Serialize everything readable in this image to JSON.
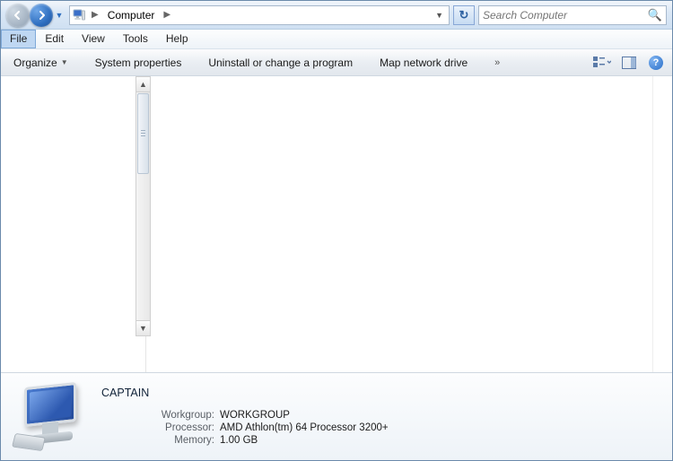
{
  "nav": {
    "breadcrumb_root": "Computer",
    "search_placeholder": "Search Computer"
  },
  "menu": {
    "file": "File",
    "edit": "Edit",
    "view": "View",
    "tools": "Tools",
    "help": "Help"
  },
  "toolbar": {
    "organize": "Organize",
    "system_properties": "System properties",
    "uninstall": "Uninstall or change a program",
    "map_drive": "Map network drive",
    "overflow": "»"
  },
  "details": {
    "computer_name": "CAPTAIN",
    "rows": [
      {
        "label": "Workgroup:",
        "value": "WORKGROUP"
      },
      {
        "label": "Processor:",
        "value": "AMD Athlon(tm) 64 Processor 3200+"
      },
      {
        "label": "Memory:",
        "value": "1.00 GB"
      }
    ]
  }
}
